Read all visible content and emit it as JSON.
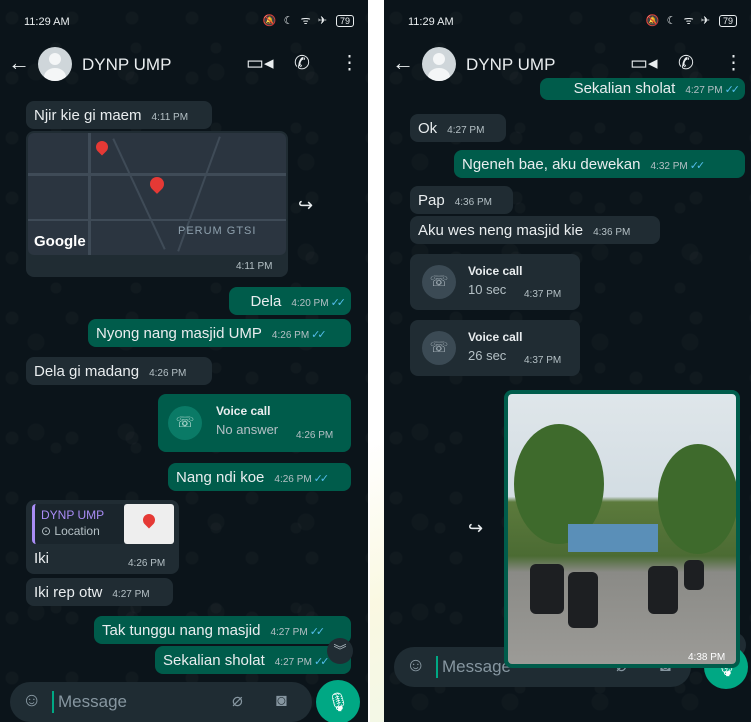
{
  "left": {
    "status": {
      "time": "11:29 AM",
      "icons": "🔕 ☾ ᯤ ✈",
      "battery": "79"
    },
    "header": {
      "contact": "DYNP UMP"
    },
    "messages": {
      "m1_text": "Njir kie gi maem",
      "m1_time": "4:11 PM",
      "map_time": "4:11 PM",
      "map_google": "Google",
      "map_label": "PERUM GTSI",
      "m2_text": "Dela",
      "m2_time": "4:20 PM",
      "m3_text": "Nyong nang masjid UMP",
      "m3_time": "4:26 PM",
      "m4_text": "Dela gi madang",
      "m4_time": "4:26 PM",
      "call1_title": "Voice call",
      "call1_sub": "No answer",
      "call1_time": "4:26 PM",
      "m5_text": "Nang ndi koe",
      "m5_time": "4:26 PM",
      "loc_name": "DYNP UMP",
      "loc_label": "Location",
      "loc_text": "Iki",
      "loc_time": "4:26 PM",
      "m6_text": "Iki rep otw",
      "m6_time": "4:27 PM",
      "m7_text": "Tak tunggu nang masjid",
      "m7_time": "4:27 PM",
      "m8_text": "Sekalian sholat",
      "m8_time": "4:27 PM"
    },
    "composer": {
      "placeholder": "Message"
    }
  },
  "right": {
    "status": {
      "time": "11:29 AM",
      "icons": "🔕 ☾ ᯤ ✈",
      "battery": "79"
    },
    "header": {
      "contact": "DYNP UMP"
    },
    "messages": {
      "m0_text": "Sekalian sholat",
      "m0_time": "4:27 PM",
      "m1_text": "Ok",
      "m1_time": "4:27 PM",
      "m2_text": "Ngeneh bae, aku dewekan",
      "m2_time": "4:32 PM",
      "m3_text": "Pap",
      "m3_time": "4:36 PM",
      "m4_text": "Aku wes neng masjid kie",
      "m4_time": "4:36 PM",
      "call1_title": "Voice call",
      "call1_sub": "10 sec",
      "call1_time": "4:37 PM",
      "call2_title": "Voice call",
      "call2_sub": "26 sec",
      "call2_time": "4:37 PM",
      "photo_time": "4:38 PM"
    },
    "composer": {
      "placeholder": "Message"
    }
  },
  "colors": {
    "incoming": "#202c33",
    "outgoing": "#005c4b",
    "background": "#0b141a",
    "accent": "#00a884",
    "read_ticks": "#53bdeb"
  },
  "icons": [
    "back-arrow-icon",
    "avatar-icon",
    "video-call-icon",
    "phone-icon",
    "more-vert-icon",
    "call-icon",
    "forward-icon",
    "emoji-icon",
    "attach-icon",
    "camera-icon",
    "mic-icon",
    "chevron-down-icon",
    "location-pin-icon"
  ]
}
